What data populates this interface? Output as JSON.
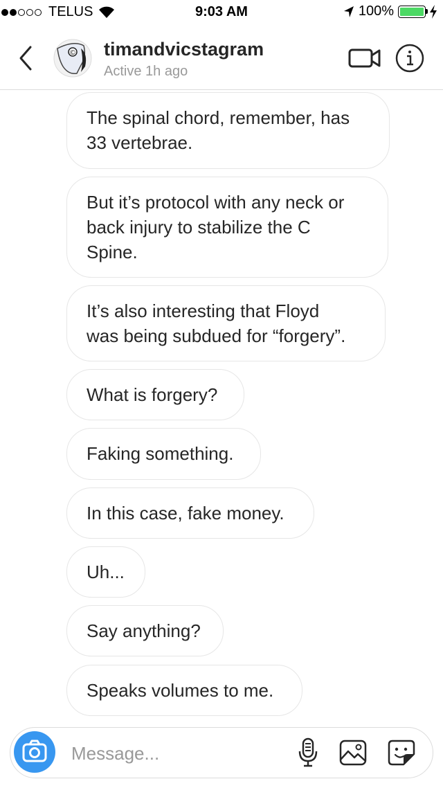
{
  "status_bar": {
    "carrier": "TELUS",
    "time": "9:03 AM",
    "battery_percent": "100%",
    "signal_strength": 2,
    "signal_total": 5
  },
  "header": {
    "username": "timandvicstagram",
    "active_status": "Active 1h ago",
    "icons": {
      "back": "chevron-left-icon",
      "video": "video-camera-icon",
      "info": "info-icon"
    }
  },
  "messages": [
    {
      "text": "The spinal chord, remember, has\n33 vertebrae."
    },
    {
      "text": "But it’s protocol with any neck or\nback injury to stabilize the C\nSpine."
    },
    {
      "text": "It’s also interesting that Floyd\nwas being subdued for “forgery”."
    },
    {
      "text": "What is forgery?"
    },
    {
      "text": "Faking something."
    },
    {
      "text": "In this case, fake money."
    },
    {
      "text": "Uh..."
    },
    {
      "text": "Say anything?"
    },
    {
      "text": "Speaks volumes to me."
    }
  ],
  "composer": {
    "placeholder": "Message...",
    "value": "",
    "icons": {
      "camera": "camera-icon",
      "mic": "microphone-icon",
      "gallery": "image-icon",
      "sticker": "sticker-icon"
    }
  },
  "colors": {
    "accent": "#3897f0",
    "bubble_border": "#e6e6e6",
    "secondary_text": "#999999",
    "battery": "#4cd964"
  }
}
